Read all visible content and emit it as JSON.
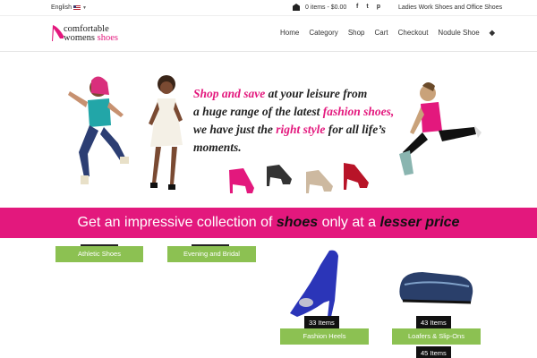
{
  "topbar": {
    "language": "English",
    "cart_text": "0 items - $0.00",
    "social": [
      "f",
      "t",
      "p"
    ],
    "tagline": "Ladies Work Shoes and Office Shoes"
  },
  "header": {
    "logo_line1": "comfortable",
    "logo_line2_a": "womens",
    "logo_line2_b": "shoes",
    "nav": [
      "Home",
      "Category",
      "Shop",
      "Cart",
      "Checkout",
      "Nodule Shoe"
    ]
  },
  "hero": {
    "line1_a": "Shop and save",
    "line1_b": " at your leisure from",
    "line2_a": "a huge range of the latest ",
    "line2_b": "fashion shoes,",
    "line3_a": "we have just the ",
    "line3_b": "right style",
    "line3_c": "  for all life’s",
    "line4": "moments."
  },
  "banner": {
    "prefix": "Get an impressive collection of ",
    "em1": "shoes",
    "middle": " only at a ",
    "em2": "lesser price"
  },
  "categories": [
    {
      "label": "Athletic Shoes"
    },
    {
      "label": "Evening and Bridal"
    },
    {
      "label": "Fashion Heels",
      "count": "33 Items"
    },
    {
      "label": "Loafers & Slip-Ons",
      "count": "43 Items"
    },
    {
      "count": "45 Items"
    }
  ],
  "colors": {
    "accent": "#e3187d",
    "category_green": "#8cc152"
  }
}
